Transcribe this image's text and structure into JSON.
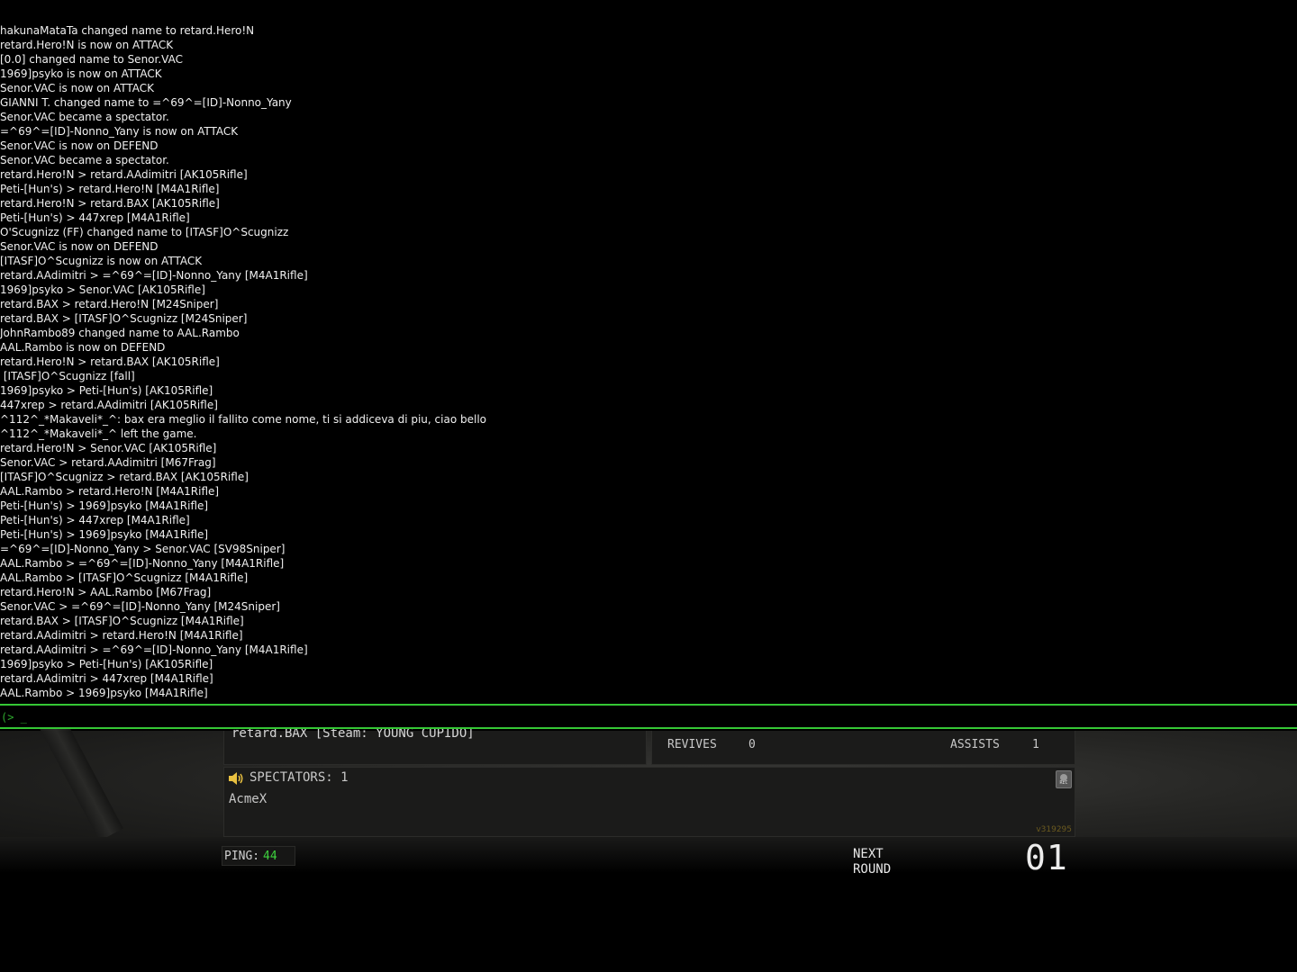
{
  "console": {
    "lines": [
      "hakunaMataTa changed name to retard.Hero!N",
      "retard.Hero!N is now on ATTACK",
      "[0.0] changed name to Senor.VAC",
      "1969]psyko is now on ATTACK",
      "Senor.VAC is now on ATTACK",
      "GIANNI T. changed name to =^69^=[ID]-Nonno_Yany",
      "Senor.VAC became a spectator.",
      "=^69^=[ID]-Nonno_Yany is now on ATTACK",
      "Senor.VAC is now on DEFEND",
      "Senor.VAC became a spectator.",
      "retard.Hero!N > retard.AAdimitri [AK105Rifle]",
      "Peti-[Hun's) > retard.Hero!N [M4A1Rifle]",
      "retard.Hero!N > retard.BAX [AK105Rifle]",
      "Peti-[Hun's) > 447xrep [M4A1Rifle]",
      "O'Scugnizz (FF) changed name to [ITASF]O^Scugnizz",
      "Senor.VAC is now on DEFEND",
      "[ITASF]O^Scugnizz is now on ATTACK",
      "retard.AAdimitri > =^69^=[ID]-Nonno_Yany [M4A1Rifle]",
      "1969]psyko > Senor.VAC [AK105Rifle]",
      "retard.BAX > retard.Hero!N [M24Sniper]",
      "retard.BAX > [ITASF]O^Scugnizz [M24Sniper]",
      "JohnRambo89 changed name to AAL.Rambo",
      "AAL.Rambo is now on DEFEND",
      "retard.Hero!N > retard.BAX [AK105Rifle]",
      " [ITASF]O^Scugnizz [fall]",
      "1969]psyko > Peti-[Hun's) [AK105Rifle]",
      "447xrep > retard.AAdimitri [AK105Rifle]",
      "^112^_*Makaveli*_^: bax era meglio il fallito come nome, ti si addiceva di piu, ciao bello",
      "^112^_*Makaveli*_^ left the game.",
      "retard.Hero!N > Senor.VAC [AK105Rifle]",
      "Senor.VAC > retard.AAdimitri [M67Frag]",
      "[ITASF]O^Scugnizz > retard.BAX [AK105Rifle]",
      "AAL.Rambo > retard.Hero!N [M4A1Rifle]",
      "Peti-[Hun's) > 1969]psyko [M4A1Rifle]",
      "Peti-[Hun's) > 447xrep [M4A1Rifle]",
      "Peti-[Hun's) > 1969]psyko [M4A1Rifle]",
      "=^69^=[ID]-Nonno_Yany > Senor.VAC [SV98Sniper]",
      "AAL.Rambo > =^69^=[ID]-Nonno_Yany [M4A1Rifle]",
      "AAL.Rambo > [ITASF]O^Scugnizz [M4A1Rifle]",
      "retard.Hero!N > AAL.Rambo [M67Frag]",
      "Senor.VAC > =^69^=[ID]-Nonno_Yany [M24Sniper]",
      "retard.BAX > [ITASF]O^Scugnizz [M4A1Rifle]",
      "retard.AAdimitri > retard.Hero!N [M4A1Rifle]",
      "retard.AAdimitri > =^69^=[ID]-Nonno_Yany [M4A1Rifle]",
      "1969]psyko > Peti-[Hun's) [AK105Rifle]",
      "retard.AAdimitri > 447xrep [M4A1Rifle]",
      "AAL.Rambo > 1969]psyko [M4A1Rifle]"
    ],
    "prompt": "(> _",
    "accent_color": "#35c735"
  },
  "scoreboard": {
    "player_name": "retard.BAX [Steam: YOUNG CUPIDO]",
    "revives_label": "REVIVES",
    "revives_value": "0",
    "assists_label": "ASSISTS",
    "assists_value": "1",
    "spectators_title": "SPECTATORS: 1",
    "spectators": [
      "AcmeX"
    ],
    "rec_label": "REC",
    "version": "v319295"
  },
  "hud": {
    "ping_label": "PING:",
    "ping_value": "44",
    "next_round_line1": "NEXT",
    "next_round_line2": "ROUND",
    "round_count": "01"
  }
}
